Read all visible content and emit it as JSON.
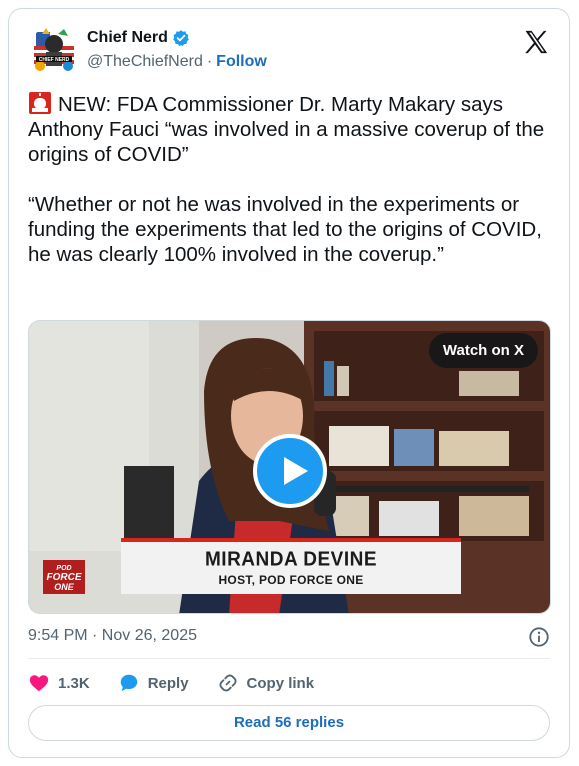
{
  "author": {
    "name": "Chief Nerd",
    "handle": "@TheChiefNerd",
    "separator": "·",
    "follow_label": "Follow"
  },
  "tweet": {
    "para1": "NEW: FDA Commissioner Dr. Marty Makary says Anthony Fauci “was involved in a massive coverup of the origins of COVID”",
    "para2": "“Whether or not he was involved in the experiments or funding the experiments that led to the origins of COVID, he was clearly 100% involved in the coverup.”"
  },
  "media": {
    "watch_label": "Watch on X",
    "lower_third_name": "MIRANDA DEVINE",
    "lower_third_title": "HOST, POD FORCE ONE",
    "logo_text_1": "POD",
    "logo_text_2": "FORCE",
    "logo_text_3": "ONE"
  },
  "timestamp": "9:54 PM · Nov 26, 2025",
  "actions": {
    "likes": "1.3K",
    "reply_label": "Reply",
    "copy_label": "Copy link"
  },
  "read_replies_label": "Read 56 replies",
  "colors": {
    "link_blue": "#1d6ebb",
    "verified_blue": "#1d9bf0",
    "like_pink": "#f91880",
    "lower_third_red": "#d8261c"
  }
}
